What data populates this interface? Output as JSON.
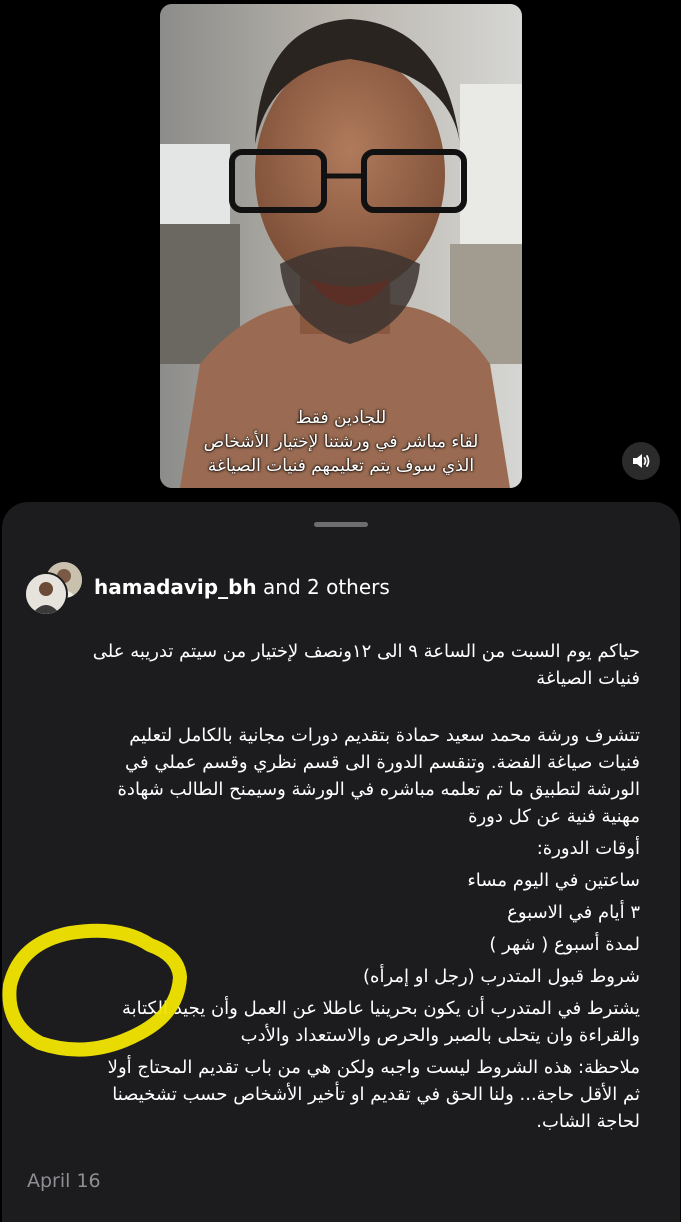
{
  "video": {
    "caption_lines": [
      "للجادين فقط",
      "لقاء مباشر في ورشتنا لإختيار الأشخاص",
      "الذي سوف يتم تعليمهم فنيات الصياغة"
    ],
    "audio_icon": "speaker-wave-icon"
  },
  "post": {
    "author": "hamadavip_bh",
    "author_suffix": " and 2 others",
    "paragraph1": [
      "حياكم يوم السبت من الساعة ٩ الى ١٢ونصف لإختيار من سيتم تدريبه على",
      "فنيات الصياغة"
    ],
    "paragraph2": [
      "تتشرف ورشة محمد سعيد حمادة بتقديم دورات مجانية بالكامل لتعليم",
      "فنيات صياغة الفضة. وتنقسم الدورة الى قسم نظري وقسم عملي في",
      "الورشة لتطبيق ما تم تعلمه مباشره في الورشة  وسيمنح الطالب شهادة",
      "مهنية فنية عن كل دورة"
    ],
    "schedule_title": "أوقات الدورة:",
    "schedule_hours": "ساعتين في اليوم  مساء",
    "schedule_days": "٣ أيام في الاسبوع",
    "schedule_duration": "لمدة أسبوع ( شهر )",
    "conditions_title": "شروط قبول المتدرب (رجل او إمرأه)",
    "conditions_body": [
      "يشترط في المتدرب أن يكون بحرينيا عاطلا عن العمل وأن يجيد الكتابة",
      "والقراءة وان يتحلى بالصبر والحرص والاستعداد والأدب"
    ],
    "note": [
      "ملاحظة: هذه الشروط ليست واجبه ولكن هي من باب تقديم المحتاج أولا",
      "ثم الأقل حاجة... ولنا الحق في تقديم او تأخير الأشخاص حسب  تشخيصنا",
      "لحاجة الشاب."
    ],
    "date": "April 16"
  },
  "colors": {
    "background": "#000000",
    "sheet": "#1c1c1e",
    "secondary_text": "#8e8e93",
    "highlight": "#f2e600"
  }
}
